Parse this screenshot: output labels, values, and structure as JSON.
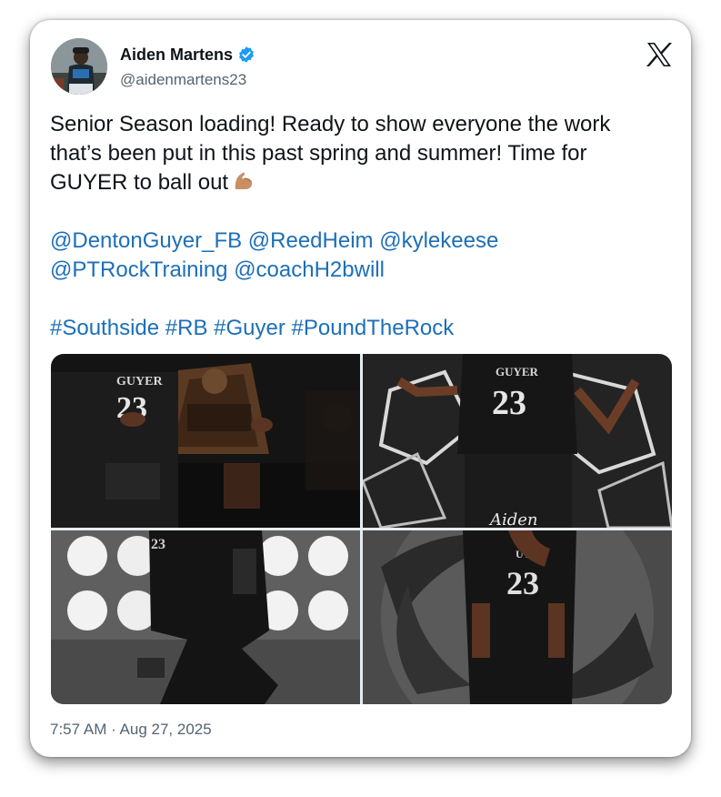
{
  "post": {
    "author_name": "Aiden Martens",
    "author_handle": "@aidenmartens23",
    "verified_icon": "verified-badge-icon",
    "platform_icon": "x-logo-icon",
    "text_line1": "Senior Season loading! Ready to show everyone the work",
    "text_line2": "that’s been put in this past spring and summer! Time for",
    "text_line3": "GUYER to ball out",
    "emoji": "flexed-biceps-icon",
    "mentions_line1": "@DentonGuyer_FB @ReedHeim @kylekeese",
    "mentions_line2": "@PTRockTraining @coachH2bwill",
    "hashtags": "#Southside #RB #Guyer #PoundTheRock",
    "timestamp": "7:57 AM · Aug 27, 2025"
  },
  "media": {
    "photo1_jersey_team": "GUYER",
    "photo1_jersey_number": "23",
    "photo2_jersey_team": "GUYER",
    "photo2_jersey_number": "23",
    "photo2_signature": "Aiden",
    "photo3_jersey_number": "23",
    "photo4_jersey_team": "UYE",
    "photo4_jersey_number": "23"
  },
  "colors": {
    "link": "#1d6fb8",
    "verified": "#1d9bf0",
    "text": "#0f1419",
    "muted": "#536471"
  }
}
